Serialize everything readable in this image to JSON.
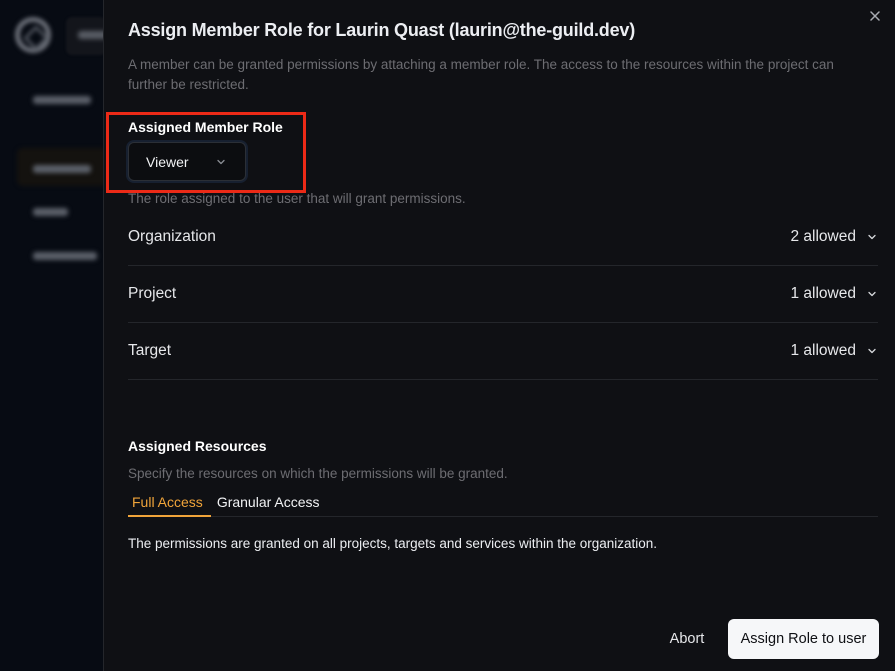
{
  "background": {
    "sidebar_items": [
      "Overview",
      "Members",
      "Roles",
      "Invitations"
    ],
    "active_item": "Members"
  },
  "dialog": {
    "title": "Assign Member Role for Laurin Quast (laurin@the-guild.dev)",
    "description": "A member can be granted permissions by attaching a member role. The access to the resources within the project can further be restricted.",
    "close_icon": "close-icon",
    "role": {
      "label": "Assigned Member Role",
      "selected": "Viewer",
      "hint": "The role assigned to the user that will grant permissions."
    },
    "permissions": [
      {
        "name": "Organization",
        "count": "2 allowed"
      },
      {
        "name": "Project",
        "count": "1 allowed"
      },
      {
        "name": "Target",
        "count": "1 allowed"
      }
    ],
    "resources": {
      "title": "Assigned Resources",
      "description": "Specify the resources on which the permissions will be granted.",
      "tabs": [
        {
          "label": "Full Access",
          "active": true
        },
        {
          "label": "Granular Access",
          "active": false
        }
      ],
      "content": "The permissions are granted on all projects, targets and services within the organization."
    },
    "actions": {
      "abort": "Abort",
      "submit": "Assign Role to user"
    }
  },
  "colors": {
    "accent": "#f0a43a",
    "highlight": "#ec2a17",
    "panel_bg": "#0f1014"
  }
}
